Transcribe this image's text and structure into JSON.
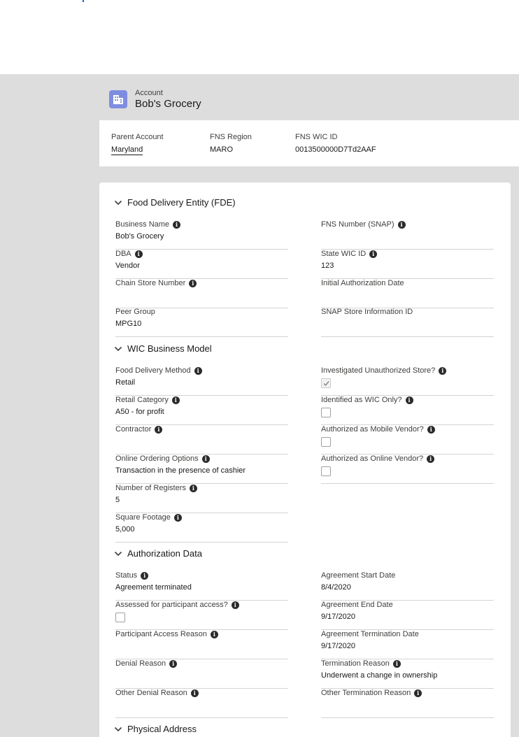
{
  "header": {
    "object_type": "Account",
    "record_name": "Bob's Grocery",
    "icon": "account-building-icon",
    "icon_color": "#7f8de1"
  },
  "highlights": {
    "parent_account_label": "Parent Account",
    "parent_account_value": "Maryland",
    "fns_region_label": "FNS Region",
    "fns_region_value": "MARO",
    "fns_wic_id_label": "FNS WIC ID",
    "fns_wic_id_value": "0013500000D7Td2AAF"
  },
  "sections": {
    "fde": {
      "title": "Food Delivery Entity (FDE)",
      "business_name_label": "Business Name",
      "business_name_value": "Bob's Grocery",
      "fns_number_label": "FNS Number (SNAP)",
      "fns_number_value": "",
      "dba_label": "DBA",
      "dba_value": "Vendor",
      "state_wic_id_label": "State WIC ID",
      "state_wic_id_value": "123",
      "chain_store_label": "Chain Store Number",
      "chain_store_value": "",
      "initial_auth_label": "Initial Authorization Date",
      "initial_auth_value": "",
      "peer_group_label": "Peer Group",
      "peer_group_value": "MPG10",
      "snap_store_label": "SNAP Store Information ID",
      "snap_store_value": ""
    },
    "wic": {
      "title": "WIC Business Model",
      "food_delivery_label": "Food Delivery Method",
      "food_delivery_value": "Retail",
      "investigated_label": "Investigated Unauthorized Store?",
      "investigated_checked": true,
      "retail_category_label": "Retail Category",
      "retail_category_value": "A50 - for profit",
      "wic_only_label": "Identified as WIC Only?",
      "wic_only_checked": false,
      "contractor_label": "Contractor",
      "contractor_value": "",
      "mobile_vendor_label": "Authorized as Mobile Vendor?",
      "mobile_vendor_checked": false,
      "online_ordering_label": "Online Ordering Options",
      "online_ordering_value": "Transaction in the presence of cashier",
      "online_vendor_label": "Authorized as Online Vendor?",
      "online_vendor_checked": false,
      "registers_label": "Number of Registers",
      "registers_value": "5",
      "square_footage_label": "Square Footage",
      "square_footage_value": "5,000"
    },
    "auth": {
      "title": "Authorization Data",
      "status_label": "Status",
      "status_value": "Agreement terminated",
      "agreement_start_label": "Agreement Start Date",
      "agreement_start_value": "8/4/2020",
      "assessed_label": "Assessed for participant access?",
      "assessed_checked": false,
      "agreement_end_label": "Agreement End Date",
      "agreement_end_value": "9/17/2020",
      "participant_reason_label": "Participant Access Reason",
      "participant_reason_value": "",
      "agreement_term_label": "Agreement Termination Date",
      "agreement_term_value": "9/17/2020",
      "denial_reason_label": "Denial Reason",
      "denial_reason_value": "",
      "termination_reason_label": "Termination Reason",
      "termination_reason_value": "Underwent a change in ownership",
      "other_denial_label": "Other Denial Reason",
      "other_denial_value": "",
      "other_termination_label": "Other Termination Reason",
      "other_termination_value": ""
    },
    "address": {
      "title": "Physical Address"
    }
  }
}
